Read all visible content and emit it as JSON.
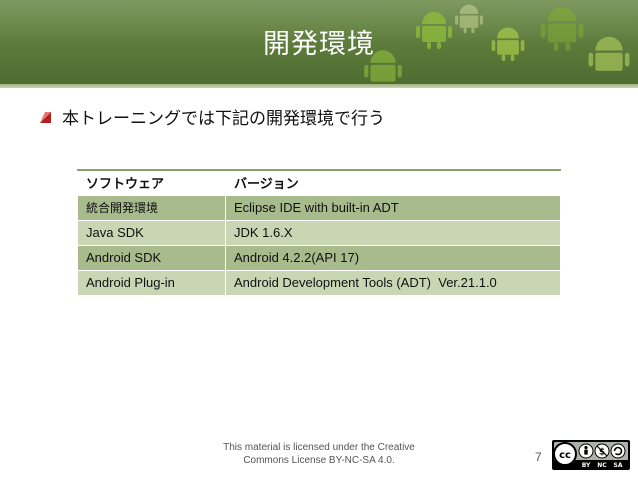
{
  "slide": {
    "title": "開発環境",
    "bullet": "本トレーニングでは下記の開発環境で行う",
    "footer_note_line1": "This material is licensed under the Creative",
    "footer_note_line2": "Commons License BY-NC-SA 4.0.",
    "page_number": "7"
  },
  "table": {
    "headers": [
      "ソフトウェア",
      "バージョン"
    ],
    "rows": [
      [
        "統合開発環境",
        "Eclipse IDE with built-in ADT"
      ],
      [
        "Java SDK",
        "JDK 1.6.X"
      ],
      [
        "Android SDK",
        "Android 4.2.2(API 17)"
      ],
      [
        "Android Plug-in",
        "Android Development Tools (ADT)  Ver.21.1.0"
      ]
    ]
  },
  "license_badge": {
    "cc": "cc",
    "by": "BY",
    "nc": "NC",
    "sa": "SA"
  },
  "colors": {
    "header_green": "#5b7a3a",
    "row_dark": "#a8bb8c",
    "row_light": "#c8d6b4",
    "bullet_red": "#b3201d"
  }
}
